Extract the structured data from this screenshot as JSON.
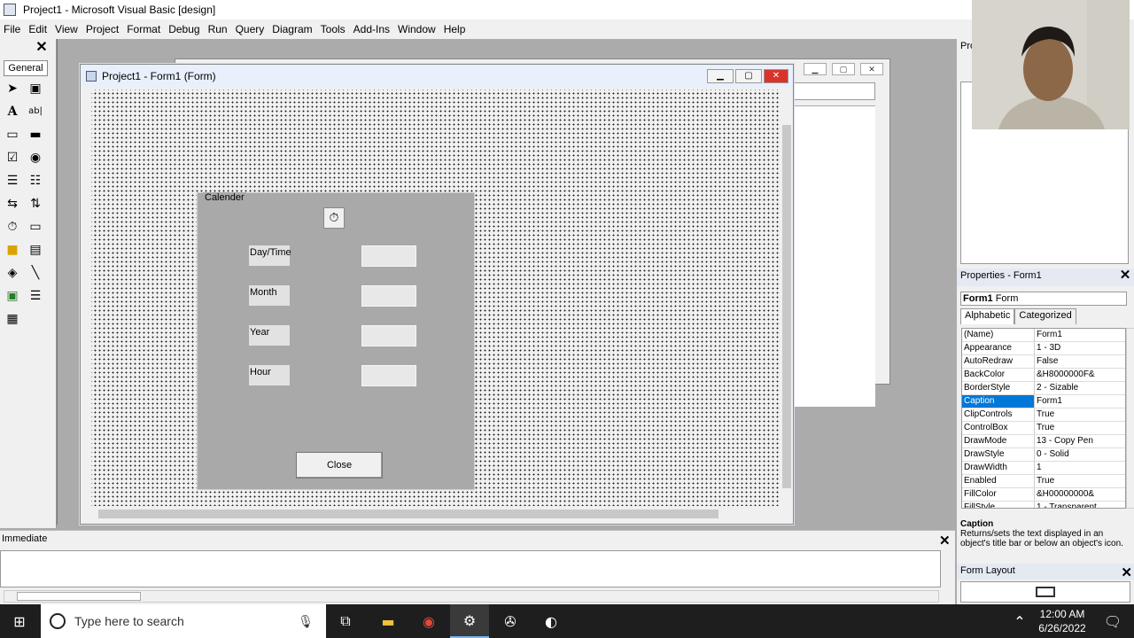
{
  "window": {
    "title": "Project1 - Microsoft Visual Basic [design]"
  },
  "menu": [
    "File",
    "Edit",
    "View",
    "Project",
    "Format",
    "Debug",
    "Run",
    "Query",
    "Diagram",
    "Tools",
    "Add-Ins",
    "Window",
    "Help"
  ],
  "toolbox": {
    "tab_label": "General",
    "close": "✕"
  },
  "form_window": {
    "title": "Project1 - Form1 (Form)"
  },
  "frame": {
    "caption": "Calender",
    "labels": [
      "Day/Time",
      "Month",
      "Year",
      "Hour"
    ],
    "close_button": "Close"
  },
  "project_panel": {
    "title": "Pro"
  },
  "properties": {
    "title": "Properties - Form1",
    "object_name": "Form1",
    "object_type": "Form",
    "tabs": [
      "Alphabetic",
      "Categorized"
    ],
    "rows": [
      {
        "name": "(Name)",
        "value": "Form1"
      },
      {
        "name": "Appearance",
        "value": "1 - 3D"
      },
      {
        "name": "AutoRedraw",
        "value": "False"
      },
      {
        "name": "BackColor",
        "value": "&H8000000F&"
      },
      {
        "name": "BorderStyle",
        "value": "2 - Sizable"
      },
      {
        "name": "Caption",
        "value": "Form1"
      },
      {
        "name": "ClipControls",
        "value": "True"
      },
      {
        "name": "ControlBox",
        "value": "True"
      },
      {
        "name": "DrawMode",
        "value": "13 - Copy Pen"
      },
      {
        "name": "DrawStyle",
        "value": "0 - Solid"
      },
      {
        "name": "DrawWidth",
        "value": "1"
      },
      {
        "name": "Enabled",
        "value": "True"
      },
      {
        "name": "FillColor",
        "value": "&H00000000&"
      },
      {
        "name": "FillStyle",
        "value": "1 - Transparent"
      }
    ],
    "selected_index": 5,
    "desc_title": "Caption",
    "desc_text": "Returns/sets the text displayed in an object's title bar or below an object's icon."
  },
  "form_layout": {
    "title": "Form Layout"
  },
  "immediate": {
    "title": "Immediate"
  },
  "taskbar": {
    "search_placeholder": "Type here to search",
    "time": "12:00 AM",
    "date": "6/26/2022"
  },
  "colors": {
    "accent": "#0078d7",
    "taskbar": "#1e1e1e",
    "frame": "#a9a9a9"
  }
}
